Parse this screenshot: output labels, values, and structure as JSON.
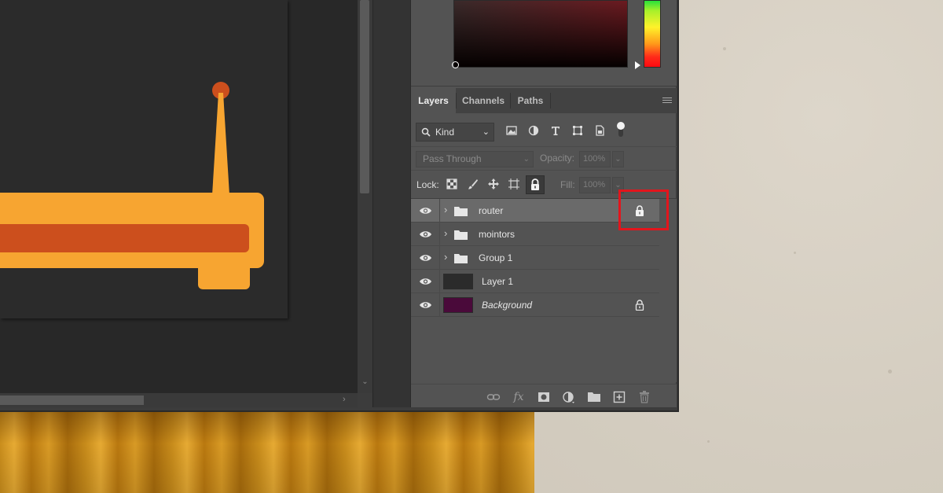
{
  "panel": {
    "tabs": [
      {
        "label": "Layers",
        "active": true
      },
      {
        "label": "Channels",
        "active": false
      },
      {
        "label": "Paths",
        "active": false
      }
    ],
    "filter": {
      "kind_label": "Kind"
    },
    "blend_mode": "Pass Through",
    "opacity_label": "Opacity:",
    "opacity_value": "100%",
    "lock_label": "Lock:",
    "fill_label": "Fill:",
    "fill_value": "100%",
    "layers": [
      {
        "name": "router",
        "type": "group",
        "selected": true,
        "locked": true,
        "visible": true
      },
      {
        "name": "mointors",
        "type": "group",
        "selected": false,
        "locked": false,
        "visible": true
      },
      {
        "name": "Group 1",
        "type": "group",
        "selected": false,
        "locked": false,
        "visible": true
      },
      {
        "name": "Layer 1",
        "type": "layer",
        "selected": false,
        "locked": false,
        "visible": true,
        "thumb_color": "#2b2b2b"
      },
      {
        "name": "Background",
        "type": "layer",
        "selected": false,
        "locked": true,
        "visible": true,
        "italic": true,
        "thumb_color": "#4a0a3a"
      }
    ]
  },
  "colors": {
    "artwork_orange": "#f7a531",
    "artwork_red": "#cc4f1d",
    "highlight": "#e3151c"
  }
}
